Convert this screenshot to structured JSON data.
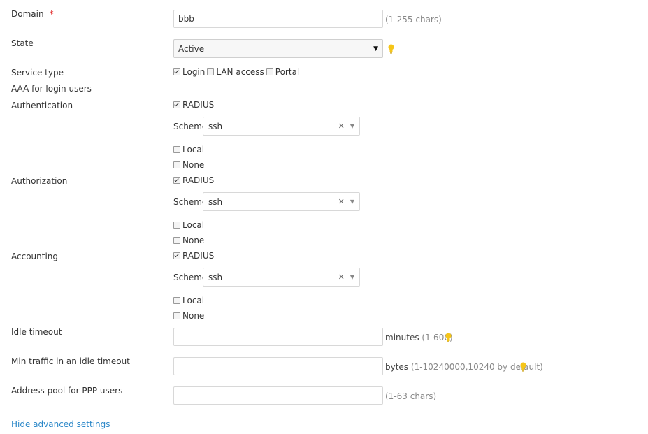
{
  "domain": {
    "label": "Domain",
    "required_mark": "*",
    "value": "bbb",
    "hint": "(1-255 chars)"
  },
  "state": {
    "label": "State",
    "selected": "Active"
  },
  "service_type": {
    "label": "Service type",
    "options": [
      {
        "label": "Login",
        "checked": true
      },
      {
        "label": "LAN access",
        "checked": false
      },
      {
        "label": "Portal",
        "checked": false
      }
    ]
  },
  "aaa_heading": "AAA for login users",
  "authentication": {
    "label": "Authentication",
    "radius": "RADIUS",
    "scheme_label": "Scheme",
    "scheme_value": "ssh",
    "local": "Local",
    "none": "None"
  },
  "authorization": {
    "label": "Authorization",
    "radius": "RADIUS",
    "scheme_label": "Scheme",
    "scheme_value": "ssh",
    "local": "Local",
    "none": "None"
  },
  "accounting": {
    "label": "Accounting",
    "radius": "RADIUS",
    "scheme_label": "Scheme",
    "scheme_value": "ssh",
    "local": "Local",
    "none": "None"
  },
  "idle_timeout": {
    "label": "Idle timeout",
    "value": "",
    "unit": "minutes",
    "range": "(1-600)"
  },
  "min_traffic": {
    "label": "Min traffic in an idle timeout",
    "value": "",
    "unit": "bytes",
    "range": "(1-10240000,10240 by default)"
  },
  "address_pool": {
    "label": "Address pool for PPP users",
    "value": "",
    "hint": "(1-63 chars)"
  },
  "advanced_link": "Hide advanced settings",
  "colors": {
    "link": "#2a87c8",
    "required": "#e02020",
    "hint_bulb": "#f5c518"
  }
}
